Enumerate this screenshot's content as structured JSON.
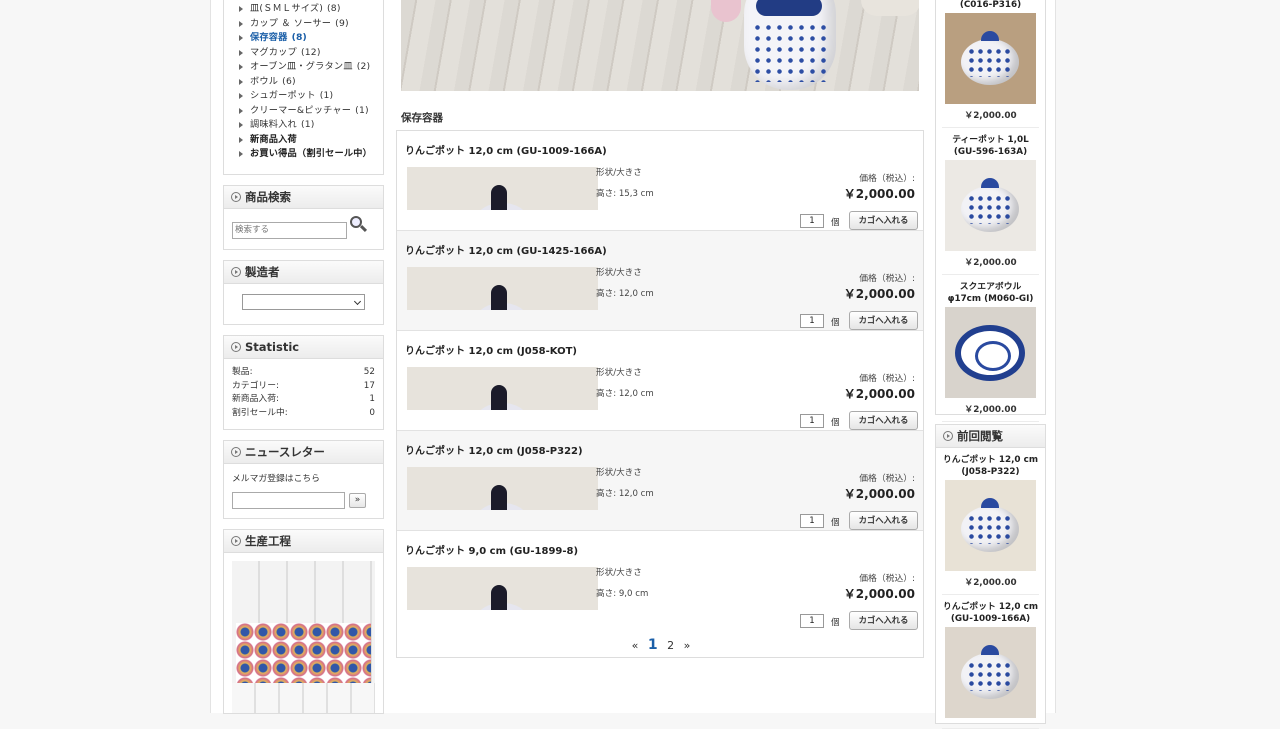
{
  "categories": {
    "items": [
      {
        "label": "皿(ＳＭＬサイズ)",
        "count": "(8)",
        "state": "normal"
      },
      {
        "label": "カップ ＆ ソーサー",
        "count": "(9)",
        "state": "normal"
      },
      {
        "label": "保存容器",
        "count": "(8)",
        "state": "active"
      },
      {
        "label": "マグカップ",
        "count": "(12)",
        "state": "normal"
      },
      {
        "label": "オーブン皿・グラタン皿",
        "count": "(2)",
        "state": "normal"
      },
      {
        "label": "ボウル",
        "count": "(6)",
        "state": "normal"
      },
      {
        "label": "シュガーポット",
        "count": "(1)",
        "state": "normal"
      },
      {
        "label": "クリーマー&ピッチャー",
        "count": "(1)",
        "state": "normal"
      },
      {
        "label": "調味料入れ",
        "count": "(1)",
        "state": "normal"
      },
      {
        "label": "新商品入荷",
        "count": "",
        "state": "bold"
      },
      {
        "label": "お買い得品（割引セール中）",
        "count": "",
        "state": "bold"
      }
    ]
  },
  "search": {
    "title": "商品検索",
    "placeholder": "検索する"
  },
  "manufacturer": {
    "title": "製造者",
    "selected": ""
  },
  "statistic": {
    "title": "Statistic",
    "rows": [
      {
        "label": "製品:",
        "value": "52"
      },
      {
        "label": "カテゴリー:",
        "value": "17"
      },
      {
        "label": "新商品入荷:",
        "value": "1"
      },
      {
        "label": "割引セール中:",
        "value": "0"
      }
    ]
  },
  "newsletter": {
    "title": "ニュースレター",
    "text": "メルマガ登録はこちら",
    "button": "»"
  },
  "production": {
    "title": "生産工程"
  },
  "main": {
    "section_title": "保存容器",
    "products": [
      {
        "title": "りんごポット 12,0 cm (GU-1009-166A)",
        "spec_head": "形状/大きさ",
        "height": "高さ: 15,3 cm",
        "price_label": "価格（税込）:",
        "price": "￥2,000.00",
        "qty": "1",
        "unit": "個",
        "cart": "カゴへ入れる"
      },
      {
        "title": "りんごポット 12,0 cm (GU-1425-166A)",
        "spec_head": "形状/大きさ",
        "height": "高さ: 12,0 cm",
        "price_label": "価格（税込）:",
        "price": "￥2,000.00",
        "qty": "1",
        "unit": "個",
        "cart": "カゴへ入れる"
      },
      {
        "title": "りんごポット 12,0 cm (J058-KOT)",
        "spec_head": "形状/大きさ",
        "height": "高さ: 12,0 cm",
        "price_label": "価格（税込）:",
        "price": "￥2,000.00",
        "qty": "1",
        "unit": "個",
        "cart": "カゴへ入れる"
      },
      {
        "title": "りんごポット 12,0 cm (J058-P322)",
        "spec_head": "形状/大きさ",
        "height": "高さ: 12,0 cm",
        "price_label": "価格（税込）:",
        "price": "￥2,000.00",
        "qty": "1",
        "unit": "個",
        "cart": "カゴへ入れる"
      },
      {
        "title": "りんごポット 9,0 cm (GU-1899-8)",
        "spec_head": "形状/大きさ",
        "height": "高さ: 9,0 cm",
        "price_label": "価格（税込）:",
        "price": "￥2,000.00",
        "qty": "1",
        "unit": "個",
        "cart": "カゴへ入れる"
      }
    ],
    "pager": {
      "prev": "«",
      "current": "1",
      "next_page": "2",
      "next": "»"
    }
  },
  "right": {
    "featured": [
      {
        "title": "(C016-P316)",
        "price": "￥2,000.00"
      },
      {
        "title": "ティーポット 1,0L (GU-596-163A)",
        "price": "￥2,000.00"
      },
      {
        "title": "スクエアボウル φ17cm (M060-GI)",
        "price": "￥2,000.00"
      }
    ],
    "recent_title": "前回閲覧",
    "recent": [
      {
        "title": "りんごポット 12,0 cm (J058-P322)",
        "price": "￥2,000.00"
      },
      {
        "title": "りんごポット 12,0 cm (GU-1009-166A)",
        "price": ""
      }
    ]
  },
  "icons": {
    "search": "magnifier-icon",
    "box_head": "circle-arrow-icon",
    "bullet": "triangle-bullet-icon"
  }
}
